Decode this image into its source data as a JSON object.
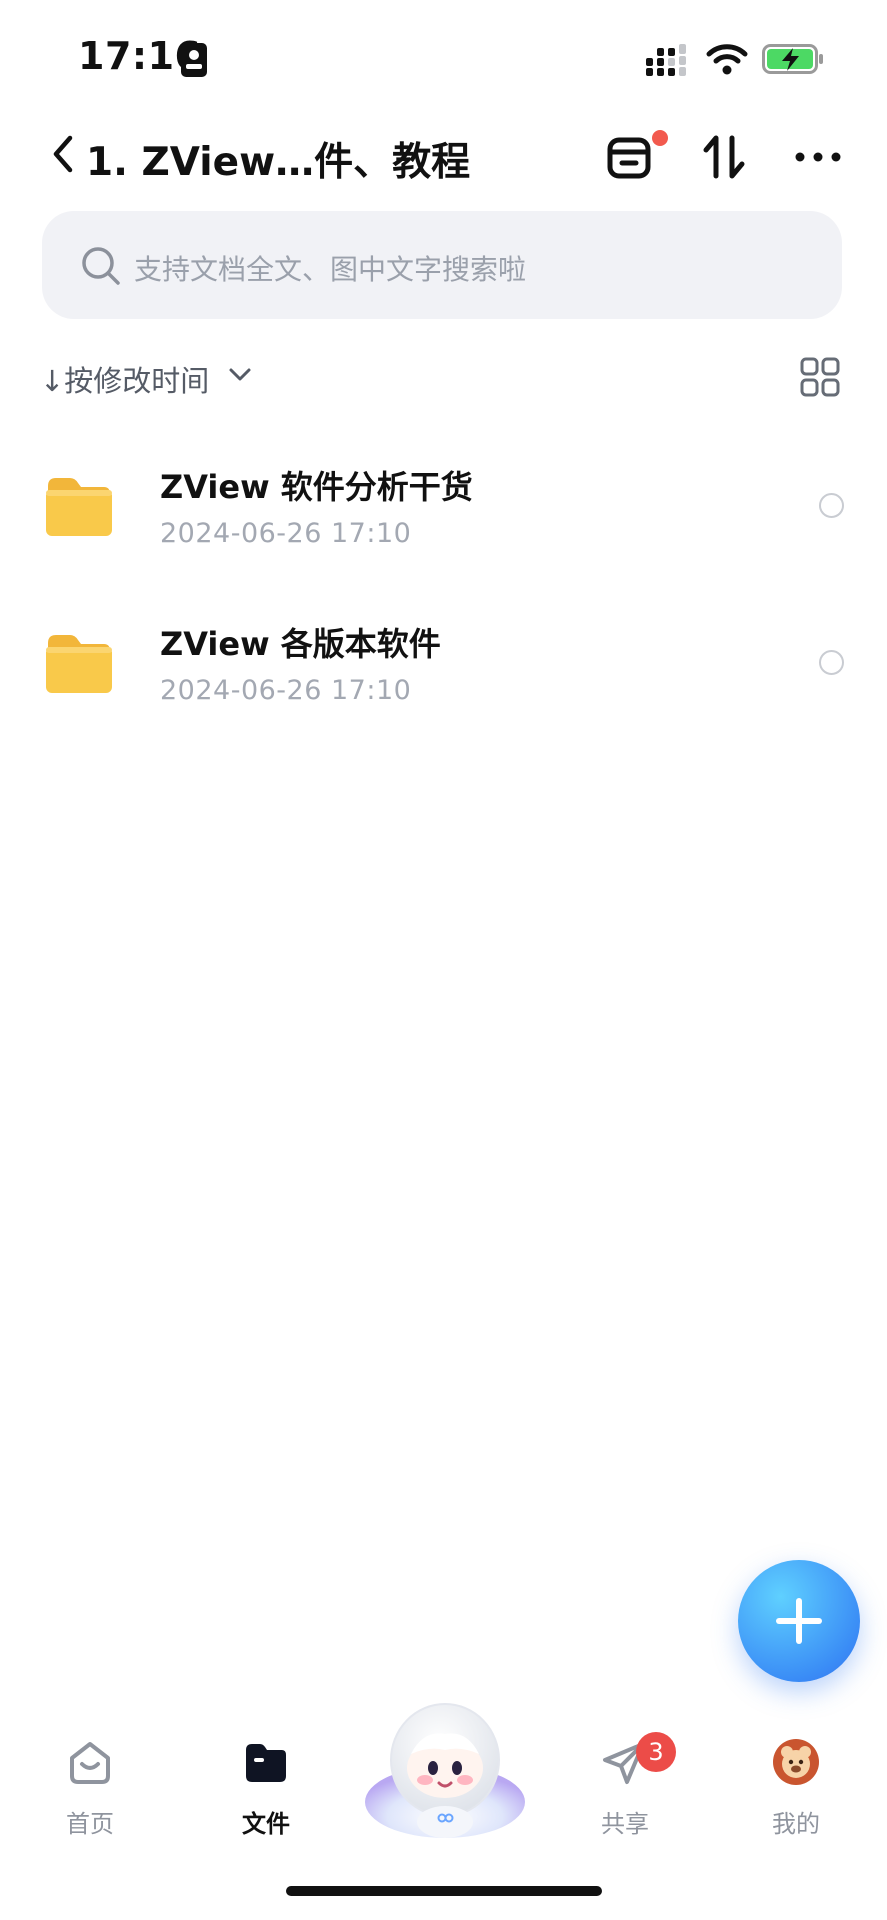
{
  "status_bar": {
    "time": "17:16"
  },
  "header": {
    "title": "1. ZView…件、教程"
  },
  "search": {
    "placeholder": "支持文档全文、图中文字搜索啦"
  },
  "sort": {
    "label": "↓按修改时间"
  },
  "files": [
    {
      "name": "ZView 软件分析干货",
      "date": "2024-06-26 17:10"
    },
    {
      "name": "ZView 各版本软件",
      "date": "2024-06-26 17:10"
    }
  ],
  "tabbar": {
    "home": "首页",
    "files": "文件",
    "share": "共享",
    "share_badge": "3",
    "me": "我的"
  },
  "colors": {
    "accent": "#3b8ef6",
    "folder": "#f9c94a",
    "badge": "#ec4c48",
    "battery": "#4cd964"
  },
  "icons": {
    "back": "chevron-left-icon",
    "recycle": "recycle-bin-icon",
    "sort": "sort-arrows-icon",
    "more": "more-icon",
    "search": "search-icon",
    "grid": "grid-view-icon",
    "folder": "folder-icon",
    "add": "plus-icon"
  }
}
